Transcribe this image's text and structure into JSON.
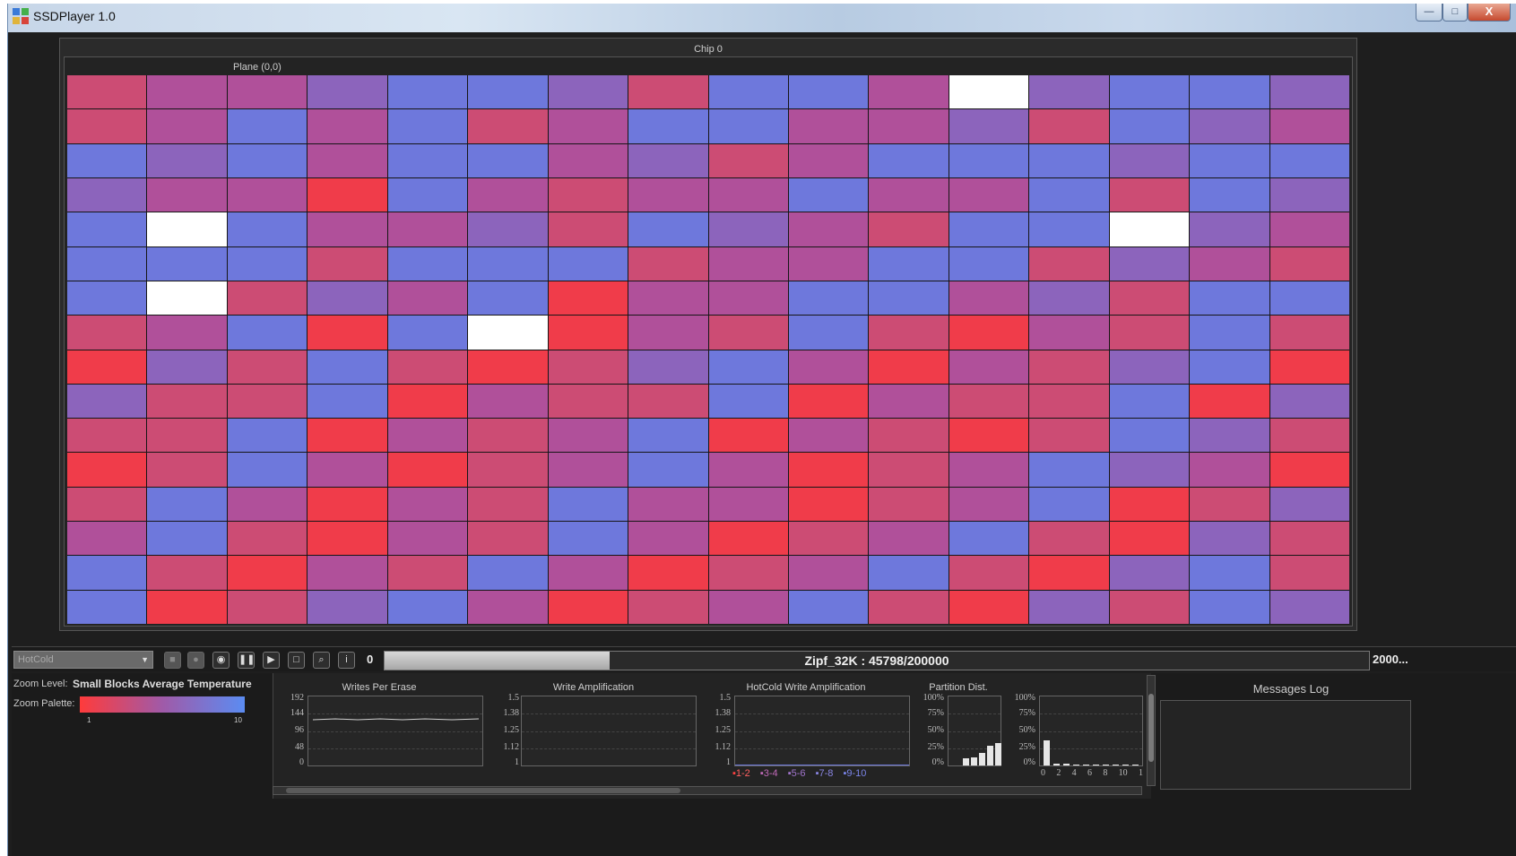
{
  "window": {
    "title": "SSDPlayer 1.0",
    "min_label": "—",
    "max_label": "□",
    "close_label": "X"
  },
  "chip": {
    "label": "Chip 0"
  },
  "plane": {
    "label": "Plane (0,0)"
  },
  "colors": {
    "hot": "#f03c4a",
    "warm": "#cc4c74",
    "mid": "#b0509a",
    "cool": "#8c64bc",
    "cold": "#6e78dc",
    "empty": "#ffffff"
  },
  "grid": {
    "rows": 16,
    "cols": 16,
    "cells": [
      "WCCCDDCWDDCECDDC",
      "WCDCDWCDDCCCWDC",
      "DCDCDDCCWCDDDCDD",
      "CCCHDCWCCDCCDWDC",
      "DEDCCCWDCCWDDECC",
      "DDDWDDDWCCDDWCCW",
      "DEWCCDHCCDDCCWDD",
      "WCDHDEHCWDWHCWDW",
      "HCWDWHWCDCHCWCDH",
      "CWWDHCWWDHCWWDHC",
      "WWDHCWCDHCWHWDCW",
      "HWDCHWCDCHWCDCCH",
      "WDCHCWDCCHWCDHWC",
      "CDWHCWDCHWCDWHCW",
      "DWHCWDCHWCDWHCDW",
      "DHWCDCHWCDWHCWDC"
    ]
  },
  "toolbar": {
    "palette_select": "HotCold",
    "buttons": [
      "pause",
      "record",
      "snapshot",
      "play-pause",
      "step",
      "stop",
      "zoom",
      "info"
    ],
    "frame_value": "0",
    "progress": 0.229,
    "progress_text": "Zipf_32K : 45798/200000",
    "progress_end": "2000..."
  },
  "zoom": {
    "level_label": "Zoom Level:",
    "level_value": "Small Blocks Average Temperature",
    "palette_label": "Zoom Palette:",
    "palette_min": "1",
    "palette_max": "10"
  },
  "charts": {
    "wpe": {
      "title": "Writes Per Erase",
      "yticks": [
        "192",
        "144",
        "96",
        "48",
        "0"
      ]
    },
    "wa": {
      "title": "Write Amplification",
      "yticks": [
        "1.5",
        "1.38",
        "1.25",
        "1.12",
        "1"
      ]
    },
    "hcwa": {
      "title": "HotCold Write Amplification",
      "yticks": [
        "1.5",
        "1.38",
        "1.25",
        "1.12",
        "1"
      ],
      "legend": [
        "1-2",
        "3-4",
        "5-6",
        "7-8",
        "9-10"
      ],
      "legend_colors": [
        "#ff4040",
        "#b05aa8",
        "#8c64bc",
        "#7b7fe0",
        "#6e78dc"
      ]
    },
    "pd": {
      "title": "Partition Dist.",
      "yticks": [
        "100%",
        "75%",
        "50%",
        "25%",
        "0%"
      ],
      "bars": [
        0.1,
        0.12,
        0.18,
        0.28,
        0.32
      ]
    },
    "hist": {
      "title": "",
      "yticks": [
        "100%",
        "75%",
        "50%",
        "25%",
        "0%"
      ],
      "xticks": [
        "0",
        "2",
        "4",
        "6",
        "8",
        "10",
        "1"
      ],
      "bars": [
        0.36,
        0.02,
        0.02,
        0.01,
        0.01,
        0.01,
        0.01,
        0.01,
        0.01,
        0.01
      ]
    }
  },
  "messages": {
    "title": "Messages Log"
  }
}
